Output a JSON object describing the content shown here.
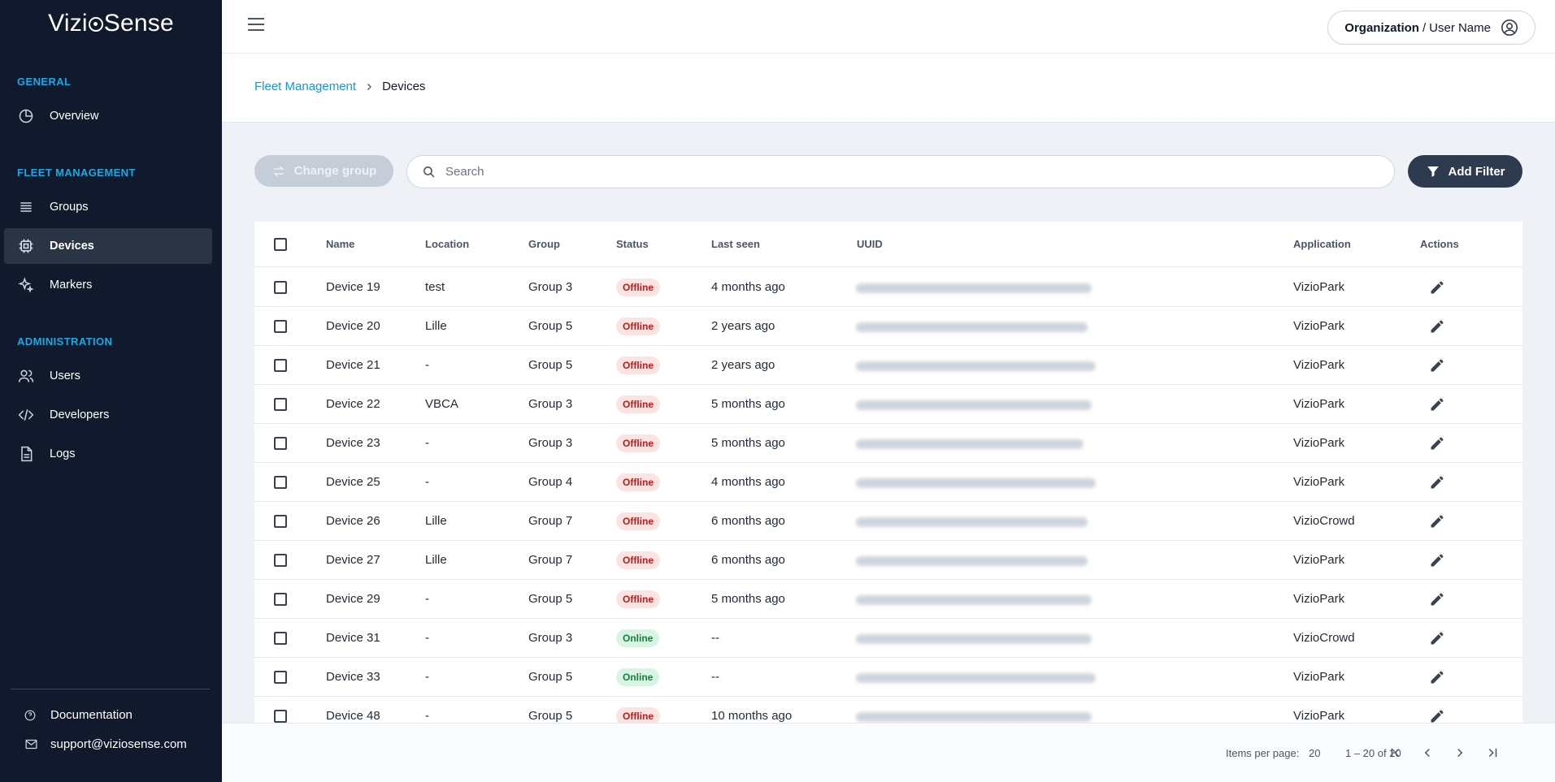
{
  "app": {
    "logo": "VizioSense",
    "logo_parts": [
      "Vizi",
      "Sense"
    ]
  },
  "sidebar": {
    "sections": [
      {
        "title": "GENERAL",
        "items": [
          {
            "label": "Overview",
            "icon": "pie-chart-icon"
          }
        ]
      },
      {
        "title": "FLEET MANAGEMENT",
        "items": [
          {
            "label": "Groups",
            "icon": "list-icon"
          },
          {
            "label": "Devices",
            "icon": "chip-icon",
            "active": true
          },
          {
            "label": "Markers",
            "icon": "sparkle-icon"
          }
        ]
      },
      {
        "title": "ADMINISTRATION",
        "items": [
          {
            "label": "Users",
            "icon": "users-icon"
          },
          {
            "label": "Developers",
            "icon": "code-icon"
          },
          {
            "label": "Logs",
            "icon": "document-icon"
          }
        ]
      }
    ],
    "footer": {
      "documentation": "Documentation",
      "support": "support@viziosense.com"
    }
  },
  "header": {
    "org": "Organization",
    "separator": "/",
    "user": "User Name"
  },
  "breadcrumb": {
    "parent": "Fleet Management",
    "current": "Devices"
  },
  "toolbar": {
    "change_group": "Change group",
    "search_placeholder": "Search",
    "add_filter": "Add Filter"
  },
  "table": {
    "columns": [
      "Name",
      "Location",
      "Group",
      "Status",
      "Last seen",
      "UUID",
      "Application",
      "Actions"
    ],
    "rows": [
      {
        "name": "Device 19",
        "location": "test",
        "group": "Group 3",
        "status": "Offline",
        "last_seen": "4 months ago",
        "application": "VizioPark"
      },
      {
        "name": "Device 20",
        "location": "Lille",
        "group": "Group 5",
        "status": "Offline",
        "last_seen": "2 years ago",
        "application": "VizioPark"
      },
      {
        "name": "Device 21",
        "location": "-",
        "group": "Group 5",
        "status": "Offline",
        "last_seen": "2 years ago",
        "application": "VizioPark"
      },
      {
        "name": "Device 22",
        "location": "VBCA",
        "group": "Group 3",
        "status": "Offline",
        "last_seen": "5 months ago",
        "application": "VizioPark"
      },
      {
        "name": "Device 23",
        "location": "-",
        "group": "Group 3",
        "status": "Offline",
        "last_seen": "5 months ago",
        "application": "VizioPark"
      },
      {
        "name": "Device 25",
        "location": "-",
        "group": "Group 4",
        "status": "Offline",
        "last_seen": "4 months ago",
        "application": "VizioPark"
      },
      {
        "name": "Device 26",
        "location": "Lille",
        "group": "Group 7",
        "status": "Offline",
        "last_seen": "6 months ago",
        "application": "VizioCrowd"
      },
      {
        "name": "Device 27",
        "location": "Lille",
        "group": "Group 7",
        "status": "Offline",
        "last_seen": "6 months ago",
        "application": "VizioPark"
      },
      {
        "name": "Device 29",
        "location": "-",
        "group": "Group 5",
        "status": "Offline",
        "last_seen": "5 months ago",
        "application": "VizioPark"
      },
      {
        "name": "Device 31",
        "location": "-",
        "group": "Group 3",
        "status": "Online",
        "last_seen": "--",
        "application": "VizioCrowd"
      },
      {
        "name": "Device 33",
        "location": "-",
        "group": "Group 5",
        "status": "Online",
        "last_seen": "--",
        "application": "VizioPark"
      },
      {
        "name": "Device 48",
        "location": "-",
        "group": "Group 5",
        "status": "Offline",
        "last_seen": "10 months ago",
        "application": "VizioPark"
      }
    ]
  },
  "pagination": {
    "items_per_page_label": "Items per page:",
    "items_per_page": "20",
    "range": "1 – 20 of 20"
  },
  "colors": {
    "sidebar_bg": "#111a2c",
    "accent": "#1797d4",
    "offline_badge": "#fde2e2",
    "online_badge": "#d8f5e4"
  }
}
